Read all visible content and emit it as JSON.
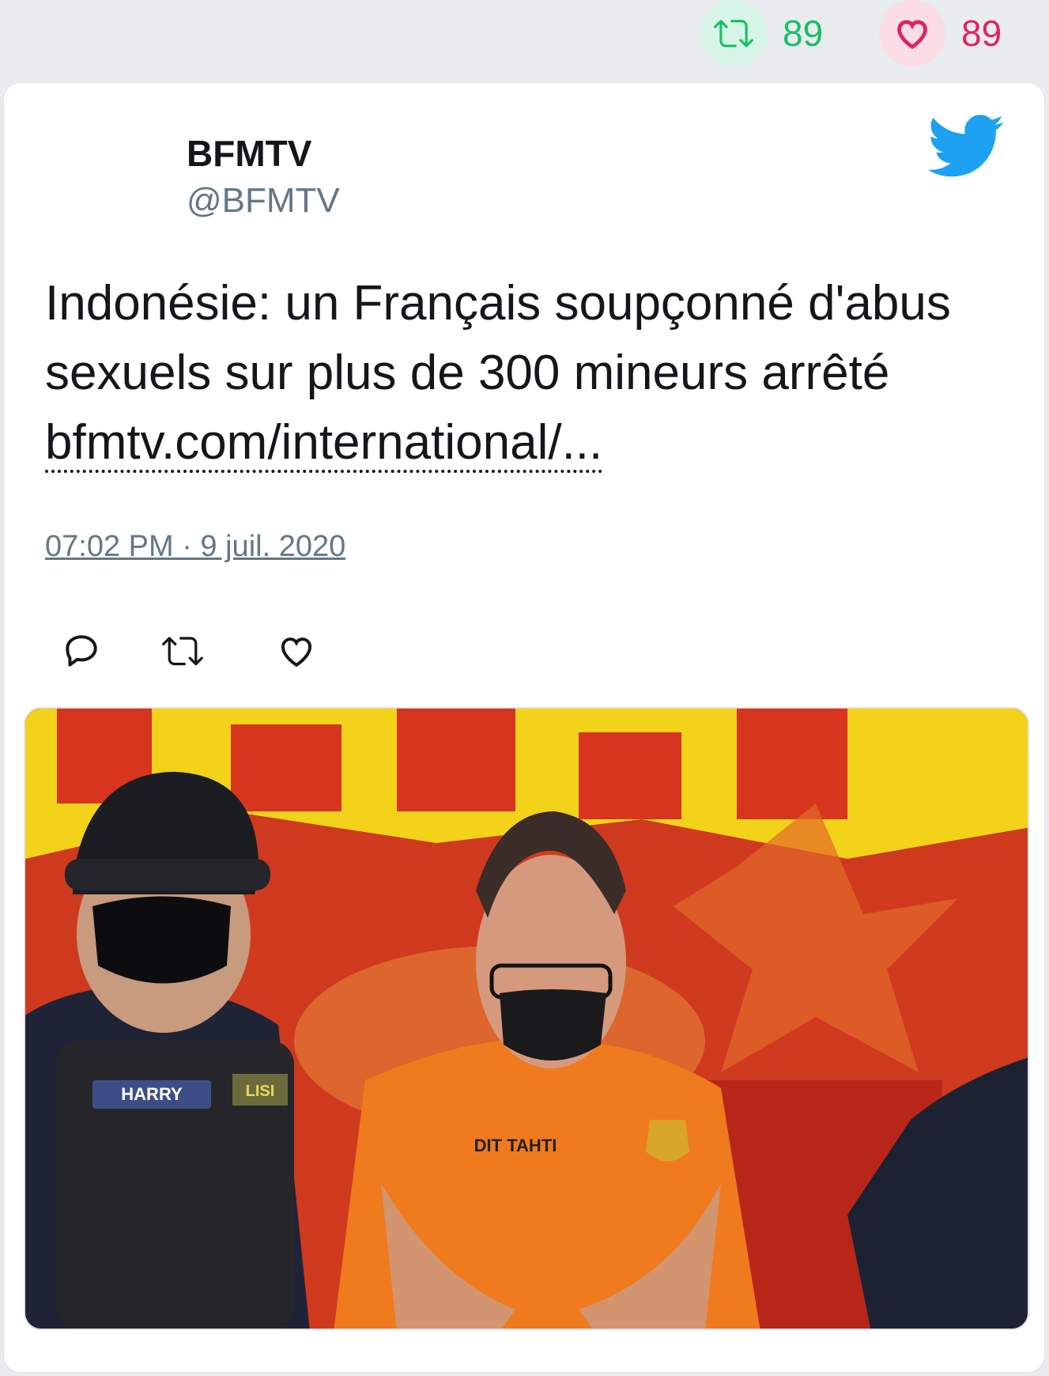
{
  "top_stats": {
    "retweet_count": "89",
    "like_count": "89"
  },
  "tweet": {
    "author_name": "BFMTV",
    "author_handle": "@BFMTV",
    "text": "Indonésie: un Français soupçonné d'abus sexuels sur plus de 300 mineurs arrêté ",
    "link_text": "bfmtv.com/international/...",
    "timestamp": "07:02 PM · 9 juil. 2020"
  },
  "media": {
    "vest_patch": "HARRY",
    "shoulder_patch": "LISI",
    "shirt_label": "DIT TAHTI"
  },
  "icons": {
    "retweet": "retweet-icon",
    "like": "heart-icon",
    "reply": "reply-icon",
    "brand": "twitter-bird-icon"
  },
  "colors": {
    "retweet": "#17bf63",
    "like": "#e0245e",
    "twitter_blue": "#1da1f2",
    "secondary_text": "#657786"
  }
}
